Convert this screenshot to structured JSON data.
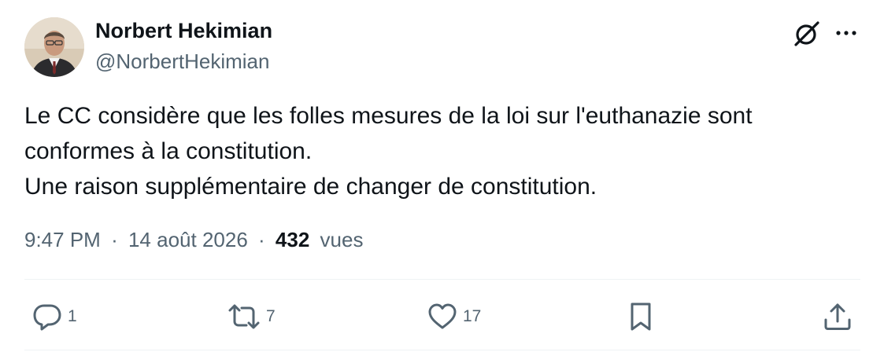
{
  "author": {
    "name": "Norbert Hekimian",
    "handle": "@NorbertHekimian"
  },
  "tweet": {
    "lines": [
      "Le CC considère que les folles mesures de la loi sur l'euthanazie sont",
      "conformes à la constitution.",
      "Une raison supplémentaire de changer de constitution."
    ],
    "time": "9:47 PM",
    "date": "14 août 2026",
    "views_count": "432",
    "views_label": "vues",
    "separator": "·"
  },
  "actions": {
    "replies": "1",
    "reposts": "7",
    "likes": "17"
  },
  "icons": {
    "top_right": [
      "grok-icon",
      "more-icon"
    ],
    "actions": [
      "reply-icon",
      "repost-icon",
      "like-icon",
      "bookmark-icon",
      "share-icon"
    ]
  },
  "colors": {
    "text_primary": "#0f1419",
    "text_secondary": "#536471",
    "divider": "#eff3f4"
  }
}
